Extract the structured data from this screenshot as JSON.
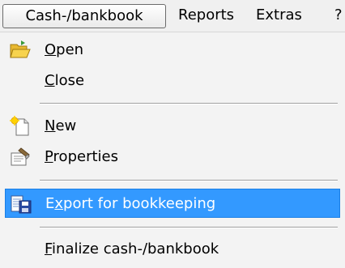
{
  "menubar": {
    "items": [
      {
        "label": "Cash-/bankbook"
      },
      {
        "label": "Reports"
      },
      {
        "label": "Extras"
      },
      {
        "label": "?"
      }
    ]
  },
  "menu": {
    "items": [
      {
        "label_mnemonic": "O",
        "label_rest": "pen",
        "icon": "folder-open-icon"
      },
      {
        "label_mnemonic": "C",
        "label_rest": "lose"
      },
      {
        "label_mnemonic": "N",
        "label_rest": "ew",
        "icon": "new-document-icon"
      },
      {
        "label_mnemonic": "P",
        "label_rest": "roperties",
        "icon": "properties-icon"
      },
      {
        "label_prefix": "E",
        "label_mnemonic": "x",
        "label_rest": "port for bookkeeping",
        "icon": "export-icon",
        "highlighted": true
      },
      {
        "label_mnemonic": "F",
        "label_rest": "inalize cash-/bankbook"
      }
    ]
  },
  "colors": {
    "highlight": "#3399ff",
    "menu_background": "#f3f3f3",
    "menubar_background": "#f0f0f0"
  }
}
